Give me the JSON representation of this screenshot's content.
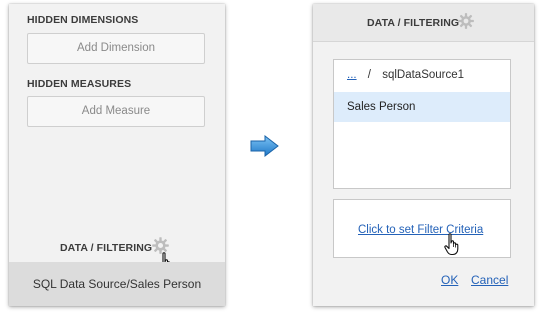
{
  "left_panel": {
    "hidden_dimensions": {
      "title": "HIDDEN DIMENSIONS",
      "button": "Add Dimension"
    },
    "hidden_measures": {
      "title": "HIDDEN MEASURES",
      "button": "Add Measure"
    },
    "data_filtering_label": "DATA / FILTERING",
    "footer": "SQL Data Source/Sales Person"
  },
  "right_panel": {
    "header": "DATA / FILTERING",
    "breadcrumb": {
      "ellipsis": "...",
      "separator": "/",
      "current": "sqlDataSource1"
    },
    "items": [
      "Sales Person"
    ],
    "filter_link": "Click to set Filter Criteria",
    "ok": "OK",
    "cancel": "Cancel"
  },
  "icons": {
    "gear": "gear-icon",
    "arrow": "arrow-right-icon",
    "cursor": "hand-pointer-icon"
  },
  "colors": {
    "link": "#2462b8",
    "arrow": "#2f8ad8",
    "selection": "#ddecfb"
  }
}
